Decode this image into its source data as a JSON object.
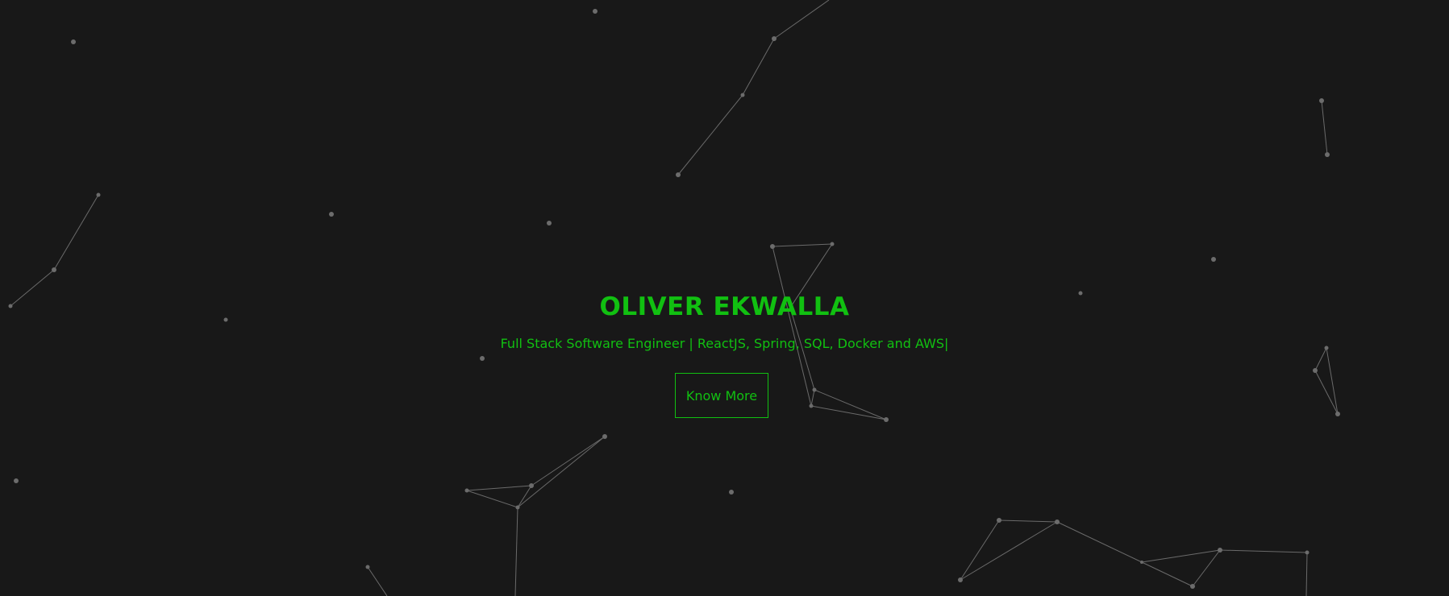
{
  "hero": {
    "name": "OLIVER EKWALLA",
    "tagline": "Full Stack Software Engineer | ReactJS, Spring, SQL, Docker and AWS",
    "cursor": "|",
    "cta_label": "Know More"
  },
  "colors": {
    "background": "#181818",
    "accent": "#11c011",
    "particle": "#6c6c6c"
  }
}
